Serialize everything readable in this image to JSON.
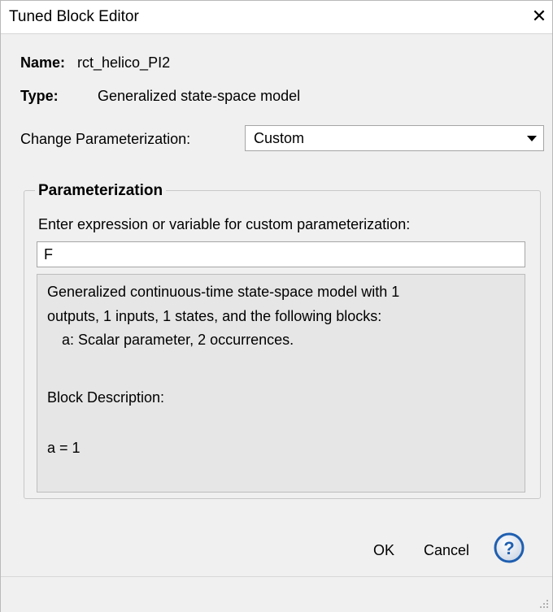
{
  "window": {
    "title": "Tuned Block Editor",
    "close_glyph": "✕"
  },
  "info": {
    "name_label": "Name:",
    "name_value": "rct_helico_PI2",
    "type_label": "Type:",
    "type_value": "Generalized state-space model"
  },
  "parameterization": {
    "change_label": "Change Parameterization:",
    "selected": "Custom",
    "group_title": "Parameterization",
    "prompt": "Enter expression or variable for custom parameterization:",
    "expression_value": "F",
    "description": [
      "Generalized continuous-time state-space model with 1",
      "outputs, 1 inputs, 1 states, and the following blocks:",
      "a: Scalar parameter, 2 occurrences.",
      "Block Description:",
      "a = 1"
    ]
  },
  "buttons": {
    "ok": "OK",
    "cancel": "Cancel",
    "help_glyph": "?"
  },
  "colors": {
    "help_blue": "#1f5fb0",
    "desc_bg": "#e6e6e6",
    "window_bg": "#f0f0f0"
  }
}
